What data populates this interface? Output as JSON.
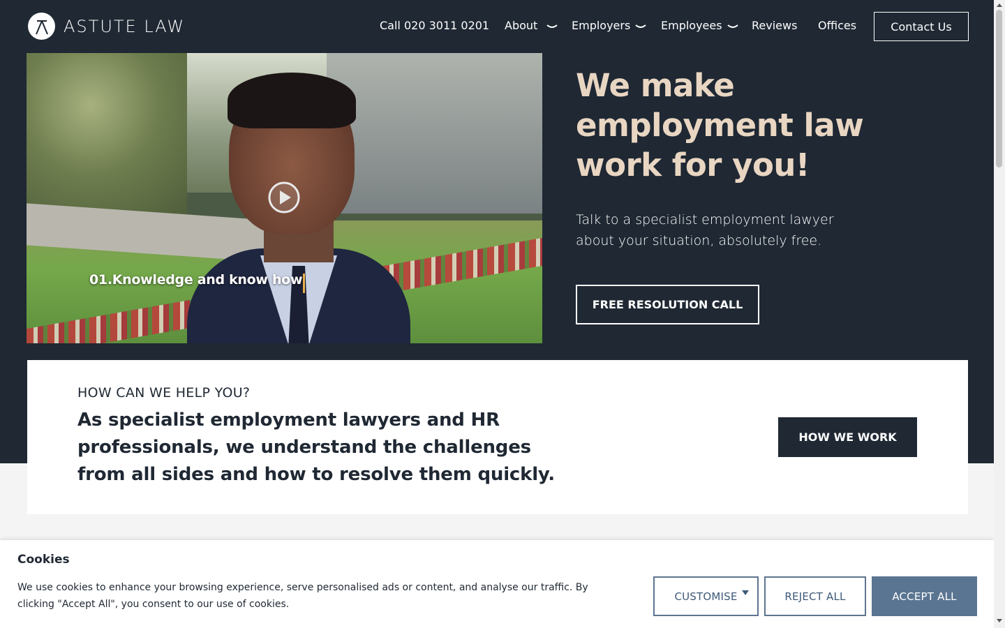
{
  "header": {
    "logo_text": "ASTUTE LAW",
    "nav": {
      "phone": "Call 020 3011 0201",
      "about": "About",
      "employers": "Employers",
      "employees": "Employees",
      "reviews": "Reviews",
      "offices": "Offices"
    },
    "contact_label": "Contact Us"
  },
  "hero": {
    "video_caption": "01.Knowledge and know how",
    "title": "We make employment law work for you!",
    "subtitle": "Talk to a specialist employment lawyer about your situation, absolutely free.",
    "cta_label": "FREE RESOLUTION CALL"
  },
  "help": {
    "eyebrow": "HOW CAN WE HELP YOU?",
    "body": "As specialist employment lawyers and HR professionals, we understand the challenges from all sides and how to resolve them quickly.",
    "button_label": "HOW WE WORK"
  },
  "cookie": {
    "title": "Cookies",
    "text": "We use cookies to enhance your browsing experience, serve personalised ads or content, and analyse our traffic. By clicking \"Accept All\", you consent to our use of cookies.",
    "customise_label": "CUSTOMISE",
    "reject_label": "REJECT ALL",
    "accept_label": "ACCEPT ALL"
  },
  "colors": {
    "hero_bg": "#1f2833",
    "accent_title": "#e9d6c2",
    "cookie_accent": "#5a7591"
  },
  "icons": {
    "logo": "astute-mark-icon",
    "chevron": "chevron-down-icon",
    "play": "play-icon",
    "caret": "caret-down-icon"
  }
}
